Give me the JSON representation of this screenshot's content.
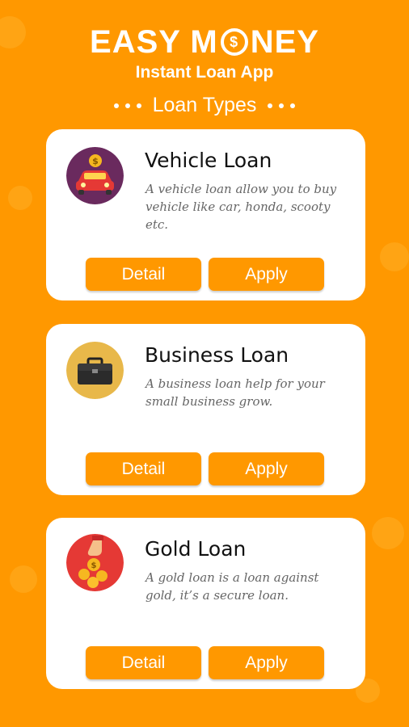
{
  "header": {
    "title_left": "EASY M",
    "title_coin": "$",
    "title_right": "NEY",
    "subtitle": "Instant Loan App",
    "section_title": "Loan Types"
  },
  "loans": [
    {
      "name": "Vehicle Loan",
      "description": "A vehicle loan allow you to buy vehicle like car, honda, scooty etc.",
      "detail_label": "Detail",
      "apply_label": "Apply",
      "icon": "car-coin-icon"
    },
    {
      "name": "Business Loan",
      "description": "A business loan help for your small business grow.",
      "detail_label": "Detail",
      "apply_label": "Apply",
      "icon": "briefcase-icon"
    },
    {
      "name": "Gold Loan",
      "description": "A gold loan is a loan against gold, it’s a secure loan.",
      "detail_label": "Detail",
      "apply_label": "Apply",
      "icon": "hand-coins-icon"
    }
  ],
  "colors": {
    "background": "#ff9800",
    "card": "#ffffff",
    "button": "#ff9800"
  }
}
